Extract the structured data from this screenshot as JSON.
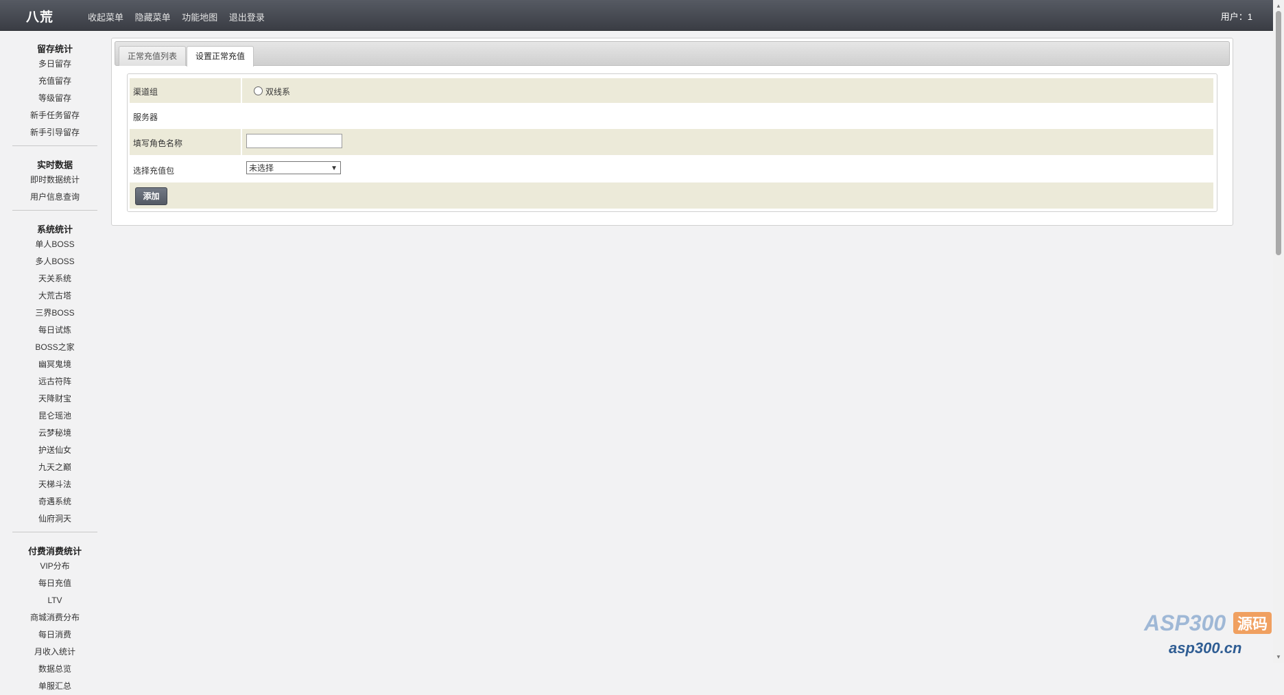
{
  "header": {
    "logo": "八荒",
    "nav": [
      "收起菜单",
      "隐藏菜单",
      "功能地图",
      "退出登录"
    ],
    "user": "用户：1"
  },
  "sidebar": {
    "sections": [
      {
        "title": "留存统计",
        "items": [
          "多日留存",
          "充值留存",
          "等级留存",
          "新手任务留存",
          "新手引导留存"
        ]
      },
      {
        "title": "实时数据",
        "items": [
          "即时数据统计",
          "用户信息查询"
        ]
      },
      {
        "title": "系统统计",
        "items": [
          "单人BOSS",
          "多人BOSS",
          "天关系统",
          "大荒古塔",
          "三界BOSS",
          "每日试炼",
          "BOSS之家",
          "幽冥鬼境",
          "远古符阵",
          "天降财宝",
          "昆仑瑶池",
          "云梦秘境",
          "护送仙女",
          "九天之巅",
          "天梯斗法",
          "奇遇系统",
          "仙府洞天"
        ]
      },
      {
        "title": "付费消费统计",
        "items": [
          "VIP分布",
          "每日充值",
          "LTV",
          "商城消费分布",
          "每日消费",
          "月收入统计",
          "数据总览",
          "单服汇总"
        ]
      }
    ]
  },
  "tabs": {
    "list": "正常充值列表",
    "set": "设置正常充值"
  },
  "form": {
    "channel_group_label": "渠道组",
    "channel_option": "双线系",
    "server_label": "服务器",
    "role_name_label": "填写角色名称",
    "role_name_value": "",
    "package_label": "选择充值包",
    "package_selected": "未选择",
    "add_button": "添加"
  },
  "watermark": {
    "brand": "ASP300",
    "tag": "源码",
    "url": "asp300.cn"
  }
}
